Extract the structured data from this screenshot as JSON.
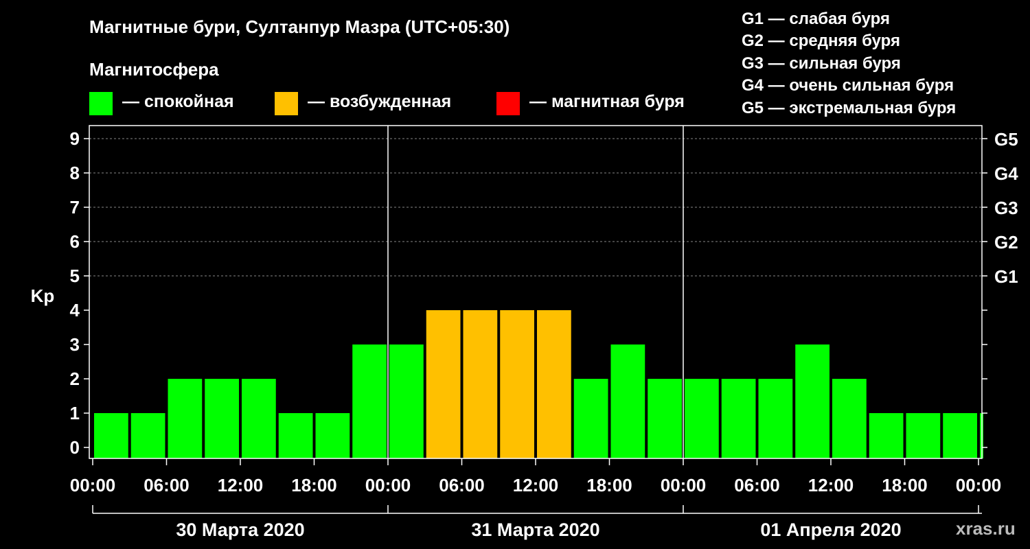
{
  "title": "Магнитные бури, Султанпур Мазра (UTC+05:30)",
  "magnetosphere_heading": "Магнитосфера",
  "legend": [
    {
      "label": "— спокойная",
      "color": "#00ff00"
    },
    {
      "label": "— возбужденная",
      "color": "#ffc000"
    },
    {
      "label": "— магнитная буря",
      "color": "#ff0000"
    }
  ],
  "g_scale": [
    "G1 — слабая буря",
    "G2 — средняя буря",
    "G3 — сильная буря",
    "G4 — очень сильная буря",
    "G5 — экстремальная буря"
  ],
  "source": "xras.ru",
  "chart_data": {
    "type": "bar",
    "ylabel": "Kp",
    "ylim": [
      0,
      9
    ],
    "yticks": [
      "0",
      "1",
      "2",
      "3",
      "4",
      "5",
      "6",
      "7",
      "8",
      "9"
    ],
    "right_ticks": [
      {
        "value": 5,
        "label": "G1"
      },
      {
        "value": 6,
        "label": "G2"
      },
      {
        "value": 7,
        "label": "G3"
      },
      {
        "value": 8,
        "label": "G4"
      },
      {
        "value": 9,
        "label": "G5"
      }
    ],
    "xticks": [
      "00:00",
      "06:00",
      "12:00",
      "18:00",
      "00:00",
      "06:00",
      "12:00",
      "18:00",
      "00:00",
      "06:00",
      "12:00",
      "18:00",
      "00:00"
    ],
    "days": [
      "30 Марта 2020",
      "31 Марта 2020",
      "01 Апреля 2020"
    ],
    "grid": "dashed horizontal at Kp 5–9",
    "colors": {
      "calm": "#00ff00",
      "excited": "#ffc000",
      "storm": "#ff0000"
    },
    "bars": [
      {
        "start_hour": 0,
        "end_hour": 3,
        "value": 1,
        "level": "calm"
      },
      {
        "start_hour": 3,
        "end_hour": 6,
        "value": 1,
        "level": "calm"
      },
      {
        "start_hour": 6,
        "end_hour": 9,
        "value": 2,
        "level": "calm"
      },
      {
        "start_hour": 9,
        "end_hour": 12,
        "value": 2,
        "level": "calm"
      },
      {
        "start_hour": 12,
        "end_hour": 15,
        "value": 2,
        "level": "calm"
      },
      {
        "start_hour": 15,
        "end_hour": 18,
        "value": 1,
        "level": "calm"
      },
      {
        "start_hour": 18,
        "end_hour": 21,
        "value": 1,
        "level": "calm"
      },
      {
        "start_hour": 21,
        "end_hour": 24,
        "value": 3,
        "level": "calm"
      },
      {
        "start_hour": 24,
        "end_hour": 27,
        "value": 3,
        "level": "calm"
      },
      {
        "start_hour": 27,
        "end_hour": 30,
        "value": 4,
        "level": "excited"
      },
      {
        "start_hour": 30,
        "end_hour": 33,
        "value": 4,
        "level": "excited"
      },
      {
        "start_hour": 33,
        "end_hour": 36,
        "value": 4,
        "level": "excited"
      },
      {
        "start_hour": 36,
        "end_hour": 39,
        "value": 4,
        "level": "excited"
      },
      {
        "start_hour": 39,
        "end_hour": 42,
        "value": 2,
        "level": "calm"
      },
      {
        "start_hour": 42,
        "end_hour": 45,
        "value": 3,
        "level": "calm"
      },
      {
        "start_hour": 45,
        "end_hour": 48,
        "value": 2,
        "level": "calm"
      },
      {
        "start_hour": 48,
        "end_hour": 51,
        "value": 2,
        "level": "calm"
      },
      {
        "start_hour": 51,
        "end_hour": 54,
        "value": 2,
        "level": "calm"
      },
      {
        "start_hour": 54,
        "end_hour": 57,
        "value": 2,
        "level": "calm"
      },
      {
        "start_hour": 57,
        "end_hour": 60,
        "value": 3,
        "level": "calm"
      },
      {
        "start_hour": 60,
        "end_hour": 63,
        "value": 2,
        "level": "calm"
      },
      {
        "start_hour": 63,
        "end_hour": 66,
        "value": 1,
        "level": "calm"
      },
      {
        "start_hour": 66,
        "end_hour": 69,
        "value": 1,
        "level": "calm"
      },
      {
        "start_hour": 69,
        "end_hour": 72,
        "value": 1,
        "level": "calm"
      },
      {
        "start_hour": 72,
        "end_hour": 72.5,
        "value": 1,
        "level": "calm"
      }
    ]
  }
}
